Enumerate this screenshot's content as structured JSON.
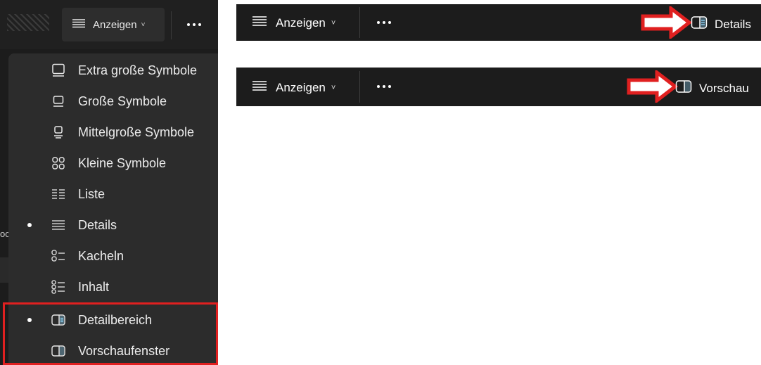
{
  "toolbar": {
    "view_label": "Anzeigen",
    "view_chevron": "˅",
    "more_icon": "more-horizontal-icon"
  },
  "view_menu": {
    "items": [
      {
        "label": "Extra große Symbole",
        "icon": "monitor-large-icon",
        "selected": false
      },
      {
        "label": "Große Symbole",
        "icon": "monitor-icon",
        "selected": false
      },
      {
        "label": "Mittelgroße Symbole",
        "icon": "monitor-small-icon",
        "selected": false
      },
      {
        "label": "Kleine Symbole",
        "icon": "small-icons-grid-icon",
        "selected": false
      },
      {
        "label": "Liste",
        "icon": "list-view-icon",
        "selected": false
      },
      {
        "label": "Details",
        "icon": "details-view-icon",
        "selected": true
      },
      {
        "label": "Kacheln",
        "icon": "tiles-view-icon",
        "selected": false
      },
      {
        "label": "Inhalt",
        "icon": "content-view-icon",
        "selected": false
      },
      {
        "label": "Detailbereich",
        "icon": "details-pane-icon",
        "selected": true
      },
      {
        "label": "Vorschaufenster",
        "icon": "preview-pane-icon",
        "selected": false
      }
    ]
  },
  "right_toolbars": [
    {
      "pane_label": "Details",
      "pane_icon": "details-pane-icon"
    },
    {
      "pane_label": "Vorschau",
      "pane_icon": "preview-pane-icon"
    }
  ],
  "colors": {
    "toolbar_bg": "#1c1c1c",
    "menu_bg": "#2c2c2c",
    "highlight": "#e02020",
    "accent_icon": "#8fd3f5"
  }
}
